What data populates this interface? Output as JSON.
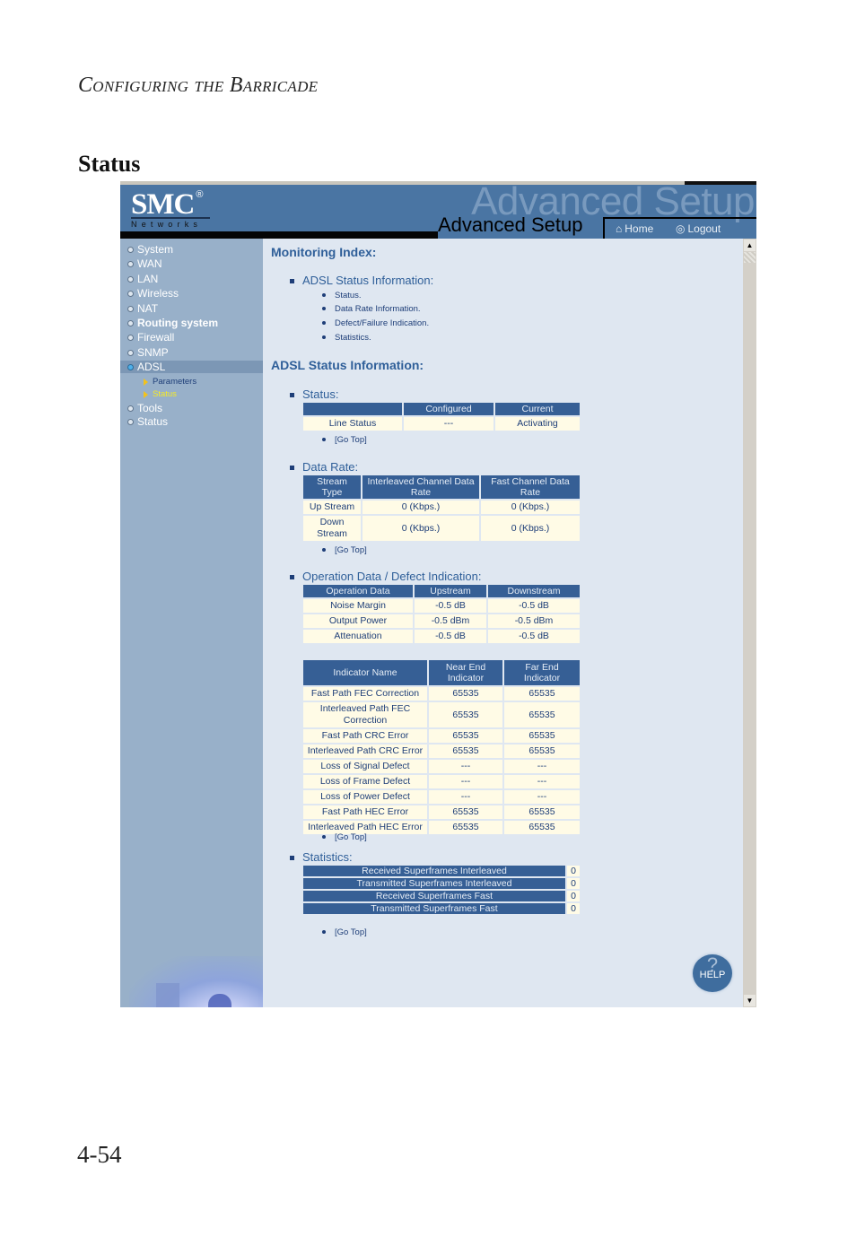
{
  "document": {
    "running_head": "Configuring the Barricade",
    "section_title": "Status",
    "page_number": "4-54"
  },
  "header": {
    "brand": "SMC",
    "brand_mark": "®",
    "brand_sub": "Networks",
    "watermark": "Advanced Setup",
    "title": "Advanced Setup",
    "nav": [
      {
        "label": "Home",
        "icon": "home-icon"
      },
      {
        "label": "Logout",
        "icon": "logout-icon"
      }
    ]
  },
  "sidebar": {
    "items": [
      {
        "label": "System"
      },
      {
        "label": "WAN"
      },
      {
        "label": "LAN"
      },
      {
        "label": "Wireless"
      },
      {
        "label": "NAT"
      },
      {
        "label": "Routing system"
      },
      {
        "label": "Firewall"
      },
      {
        "label": "SNMP"
      },
      {
        "label": "ADSL",
        "active": true
      },
      {
        "label": "Tools"
      },
      {
        "label": "Status"
      }
    ],
    "sub_items": [
      {
        "label": "Parameters"
      },
      {
        "label": "Status",
        "current": true
      }
    ]
  },
  "main": {
    "monitoring_index_title": "Monitoring Index:",
    "index_section": "ADSL Status Information:",
    "index_links": [
      "Status.",
      "Data Rate Information.",
      "Defect/Failure Indication.",
      "Statistics."
    ],
    "adsl_title": "ADSL Status Information:",
    "go_top": "[Go Top]",
    "status": {
      "title": "Status:",
      "headers": [
        "",
        "Configured",
        "Current"
      ],
      "rows": [
        [
          "Line Status",
          "---",
          "Activating"
        ]
      ]
    },
    "data_rate": {
      "title": "Data Rate:",
      "headers": [
        "Stream Type",
        "Interleaved Channel Data Rate",
        "Fast Channel Data Rate"
      ],
      "rows": [
        [
          "Up Stream",
          "0 (Kbps.)",
          "0 (Kbps.)"
        ],
        [
          "Down Stream",
          "0 (Kbps.)",
          "0 (Kbps.)"
        ]
      ]
    },
    "operation": {
      "title": "Operation Data / Defect Indication:",
      "headers": [
        "Operation Data",
        "Upstream",
        "Downstream"
      ],
      "rows": [
        [
          "Noise Margin",
          "-0.5 dB",
          "-0.5 dB"
        ],
        [
          "Output Power",
          "-0.5 dBm",
          "-0.5 dBm"
        ],
        [
          "Attenuation",
          "-0.5 dB",
          "-0.5 dB"
        ]
      ]
    },
    "indicators": {
      "headers": [
        "Indicator Name",
        "Near End Indicator",
        "Far End Indicator"
      ],
      "rows": [
        [
          "Fast Path FEC Correction",
          "65535",
          "65535"
        ],
        [
          "Interleaved Path FEC Correction",
          "65535",
          "65535"
        ],
        [
          "Fast Path CRC Error",
          "65535",
          "65535"
        ],
        [
          "Interleaved Path CRC Error",
          "65535",
          "65535"
        ],
        [
          "Loss of Signal Defect",
          "---",
          "---"
        ],
        [
          "Loss of Frame Defect",
          "---",
          "---"
        ],
        [
          "Loss of Power Defect",
          "---",
          "---"
        ],
        [
          "Fast Path HEC Error",
          "65535",
          "65535"
        ],
        [
          "Interleaved Path HEC Error",
          "65535",
          "65535"
        ]
      ]
    },
    "statistics": {
      "title": "Statistics:",
      "rows": [
        [
          "Received Superframes Interleaved",
          "0"
        ],
        [
          "Transmitted Superframes Interleaved",
          "0"
        ],
        [
          "Received Superframes Fast",
          "0"
        ],
        [
          "Transmitted Superframes Fast",
          "0"
        ]
      ]
    },
    "help_label": "HELP"
  }
}
